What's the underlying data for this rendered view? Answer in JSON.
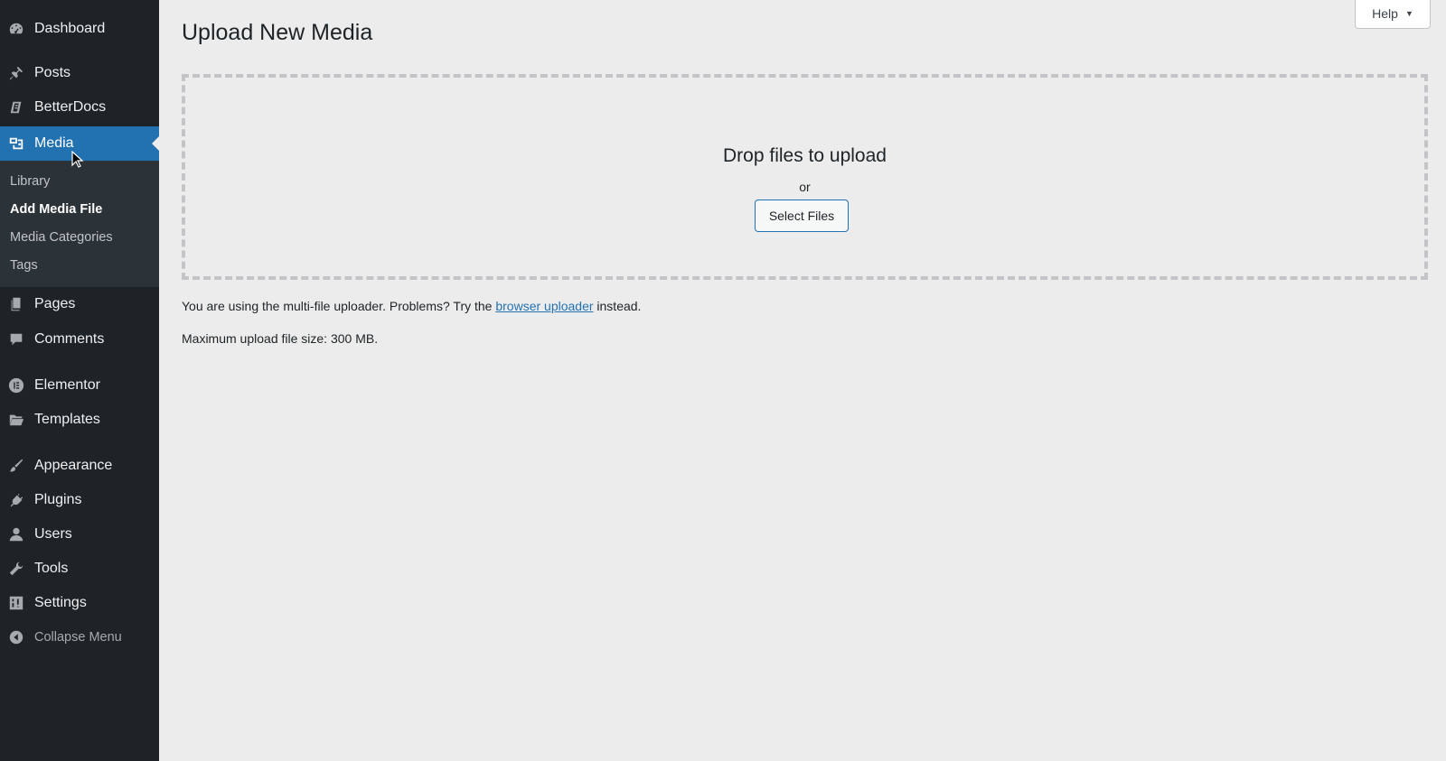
{
  "sidebar": {
    "items": [
      {
        "label": "Dashboard",
        "icon": "dashboard-icon"
      },
      {
        "label": "Posts",
        "icon": "pin-icon"
      },
      {
        "label": "BetterDocs",
        "icon": "docs-icon"
      },
      {
        "label": "Media",
        "icon": "media-icon",
        "active": true
      },
      {
        "label": "Pages",
        "icon": "pages-icon"
      },
      {
        "label": "Comments",
        "icon": "comment-icon"
      },
      {
        "label": "Elementor",
        "icon": "elementor-icon"
      },
      {
        "label": "Templates",
        "icon": "folder-icon"
      },
      {
        "label": "Appearance",
        "icon": "brush-icon"
      },
      {
        "label": "Plugins",
        "icon": "plug-icon"
      },
      {
        "label": "Users",
        "icon": "user-icon"
      },
      {
        "label": "Tools",
        "icon": "wrench-icon"
      },
      {
        "label": "Settings",
        "icon": "settings-icon"
      }
    ],
    "submenu": [
      {
        "label": "Library"
      },
      {
        "label": "Add Media File",
        "current": true
      },
      {
        "label": "Media Categories"
      },
      {
        "label": "Tags"
      }
    ],
    "collapse_label": "Collapse Menu",
    "colors": {
      "background": "#1d2327",
      "active": "#2271b1",
      "submenu_bg": "#2c3338"
    }
  },
  "main": {
    "title": "Upload New Media",
    "help_label": "Help",
    "drop_text": "Drop files to upload",
    "or_text": "or",
    "select_files_label": "Select Files",
    "note_before": "You are using the multi-file uploader. Problems? Try the ",
    "note_link": "browser uploader",
    "note_after": " instead.",
    "max_size": "Maximum upload file size: 300 MB."
  }
}
